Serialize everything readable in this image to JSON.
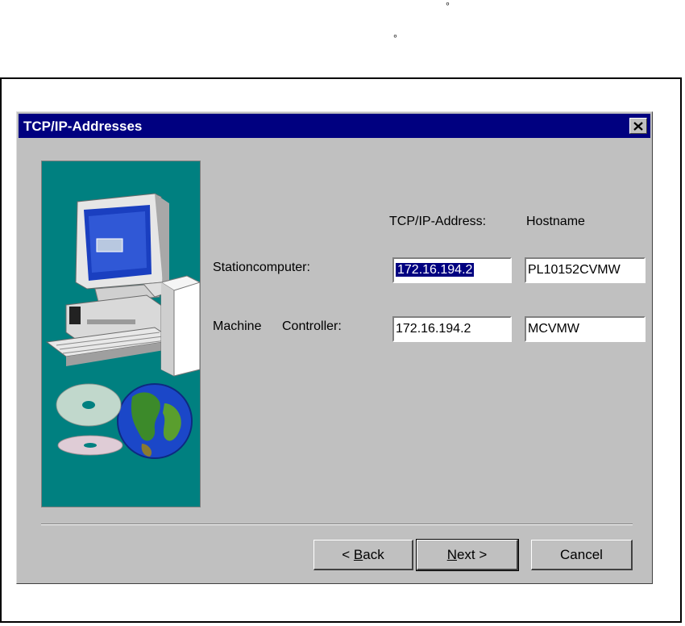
{
  "dialog": {
    "title": "TCP/IP-Addresses"
  },
  "headers": {
    "address": "TCP/IP-Address:",
    "hostname": "Hostname"
  },
  "rows": [
    {
      "label": "Stationcomputer:",
      "address": "172.16.194.2",
      "hostname": "PL10152CVMW"
    },
    {
      "label_1": "Machine",
      "label_2": "Controller:",
      "address": "172.16.194.2",
      "hostname": "MCVMW"
    }
  ],
  "buttons": {
    "back": {
      "prefix": "< ",
      "accel": "B",
      "rest": "ack"
    },
    "next": {
      "accel": "N",
      "rest": "ext >"
    },
    "cancel": "Cancel"
  },
  "icons": [
    "close-icon",
    "computer-illustration",
    "globe-illustration",
    "cd-illustration"
  ],
  "colors": {
    "titlebar": "#000080",
    "panel": "#008080",
    "dialog": "#c0c0c0"
  }
}
